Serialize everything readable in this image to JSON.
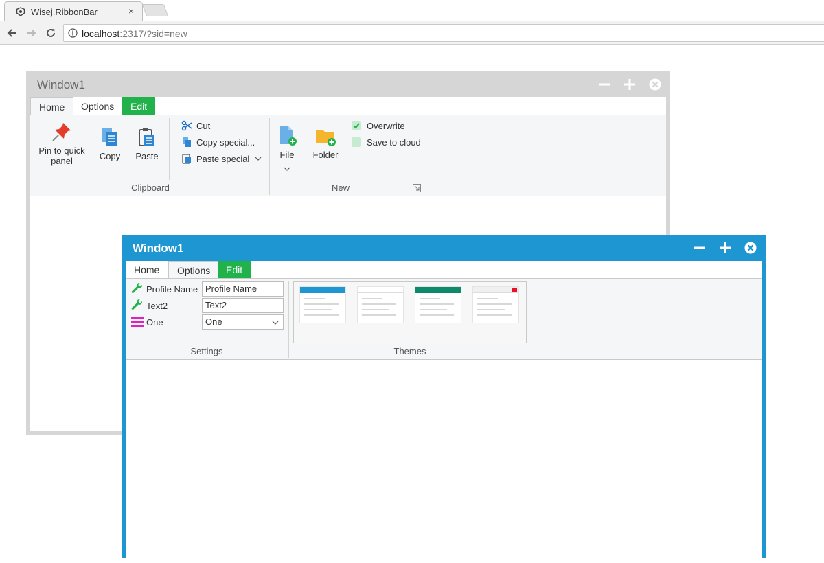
{
  "browser": {
    "tab_title": "Wisej.RibbonBar",
    "tab_close": "×",
    "url_host": "localhost",
    "url_rest": ":2317/?sid=new"
  },
  "window_back": {
    "title": "Window1",
    "ribbon": {
      "tabs": [
        "Home",
        "Options",
        "Edit"
      ],
      "clipboard": {
        "group_label": "Clipboard",
        "pin_label_1": "Pin to quick",
        "pin_label_2": "panel",
        "copy_label": "Copy",
        "paste_label": "Paste",
        "cut_label": "Cut",
        "copy_special_label": "Copy special...",
        "paste_special_label": "Paste special"
      },
      "new": {
        "group_label": "New",
        "file_label": "File",
        "folder_label": "Folder",
        "overwrite_label": "Overwrite",
        "overwrite_checked": true,
        "save_cloud_label": "Save to cloud",
        "save_cloud_checked": false
      }
    }
  },
  "window_front": {
    "title": "Window1",
    "ribbon": {
      "tabs": [
        "Home",
        "Options",
        "Edit"
      ],
      "settings": {
        "group_label": "Settings",
        "profile_name_label": "Profile Name",
        "profile_name_value": "Profile Name",
        "text2_label": "Text2",
        "text2_value": "Text2",
        "one_label": "One",
        "one_value": "One"
      },
      "themes": {
        "group_label": "Themes"
      }
    }
  },
  "colors": {
    "accent_blue": "#1e96d2",
    "edit_green": "#22b24c",
    "wrench_green": "#22b24c",
    "menu_magenta": "#e020c0"
  }
}
